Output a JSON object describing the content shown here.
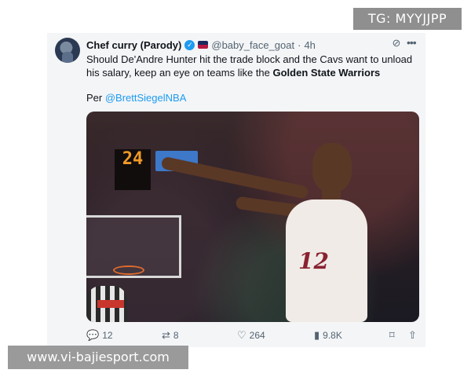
{
  "watermarks": {
    "top": "TG: MYYJJPP",
    "bottom": "www.vi-bajiesport.com"
  },
  "tweet": {
    "author_name": "Chef curry (Parody)",
    "handle": "@baby_face_goat",
    "separator": "·",
    "time": "4h",
    "text_main": "Should De'Andre Hunter hit the trade block and the Cavs want to unload his salary, keep an eye on teams like the ",
    "text_bold": "Golden State Warriors",
    "per_label": "Per ",
    "per_mention": "@BrettSiegelNBA",
    "image": {
      "scoreboard": "24",
      "jersey_number": "12"
    },
    "icons": {
      "verified": "verified-badge-icon",
      "flag": "flag-icon",
      "grok": "grok-icon",
      "more": "more-icon",
      "reply": "reply-icon",
      "retweet": "retweet-icon",
      "like": "like-icon",
      "views": "views-icon",
      "bookmark": "bookmark-icon",
      "share": "share-icon"
    },
    "stats": {
      "replies": "12",
      "retweets": "8",
      "likes": "264",
      "views": "9.8K"
    }
  }
}
